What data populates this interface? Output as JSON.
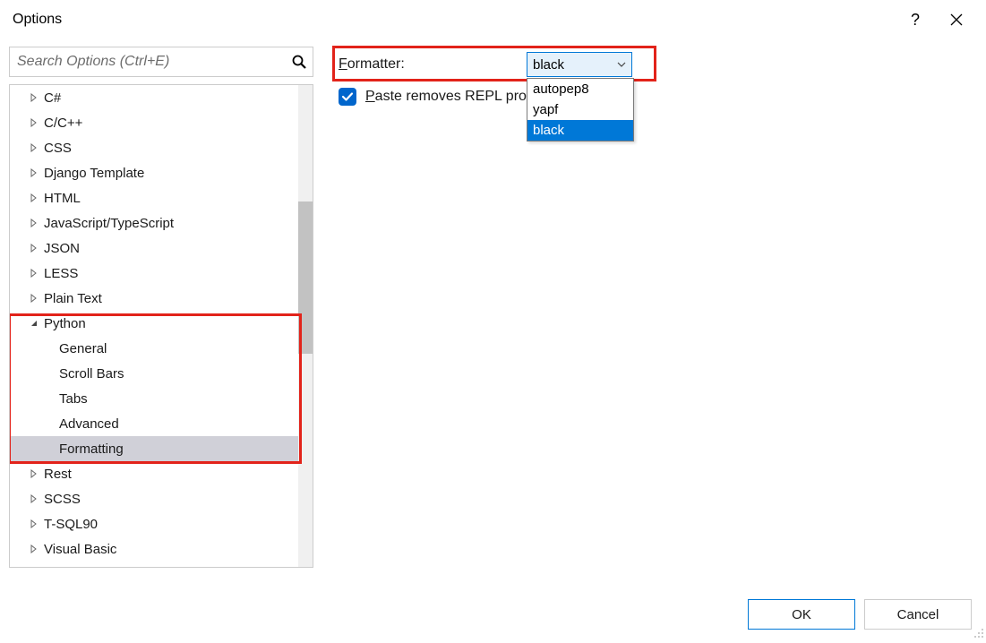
{
  "title": "Options",
  "search": {
    "placeholder": "Search Options (Ctrl+E)"
  },
  "tree": {
    "items": [
      {
        "label": "C#",
        "expanded": false,
        "depth": 0
      },
      {
        "label": "C/C++",
        "expanded": false,
        "depth": 0
      },
      {
        "label": "CSS",
        "expanded": false,
        "depth": 0
      },
      {
        "label": "Django Template",
        "expanded": false,
        "depth": 0
      },
      {
        "label": "HTML",
        "expanded": false,
        "depth": 0
      },
      {
        "label": "JavaScript/TypeScript",
        "expanded": false,
        "depth": 0
      },
      {
        "label": "JSON",
        "expanded": false,
        "depth": 0
      },
      {
        "label": "LESS",
        "expanded": false,
        "depth": 0
      },
      {
        "label": "Plain Text",
        "expanded": false,
        "depth": 0
      },
      {
        "label": "Python",
        "expanded": true,
        "depth": 0
      },
      {
        "label": "General",
        "expanded": null,
        "depth": 1
      },
      {
        "label": "Scroll Bars",
        "expanded": null,
        "depth": 1
      },
      {
        "label": "Tabs",
        "expanded": null,
        "depth": 1
      },
      {
        "label": "Advanced",
        "expanded": null,
        "depth": 1
      },
      {
        "label": "Formatting",
        "expanded": null,
        "depth": 1,
        "selected": true
      },
      {
        "label": "Rest",
        "expanded": false,
        "depth": 0
      },
      {
        "label": "SCSS",
        "expanded": false,
        "depth": 0
      },
      {
        "label": "T-SQL90",
        "expanded": false,
        "depth": 0
      },
      {
        "label": "Visual Basic",
        "expanded": false,
        "depth": 0
      }
    ]
  },
  "formatter": {
    "label_prefix": "F",
    "label_rest": "ormatter:",
    "value": "black",
    "options": [
      "autopep8",
      "yapf",
      "black"
    ],
    "highlighted": "black"
  },
  "paste": {
    "checked": true,
    "label_prefix": "P",
    "label_rest": "aste removes REPL prompts"
  },
  "buttons": {
    "ok": "OK",
    "cancel": "Cancel"
  }
}
